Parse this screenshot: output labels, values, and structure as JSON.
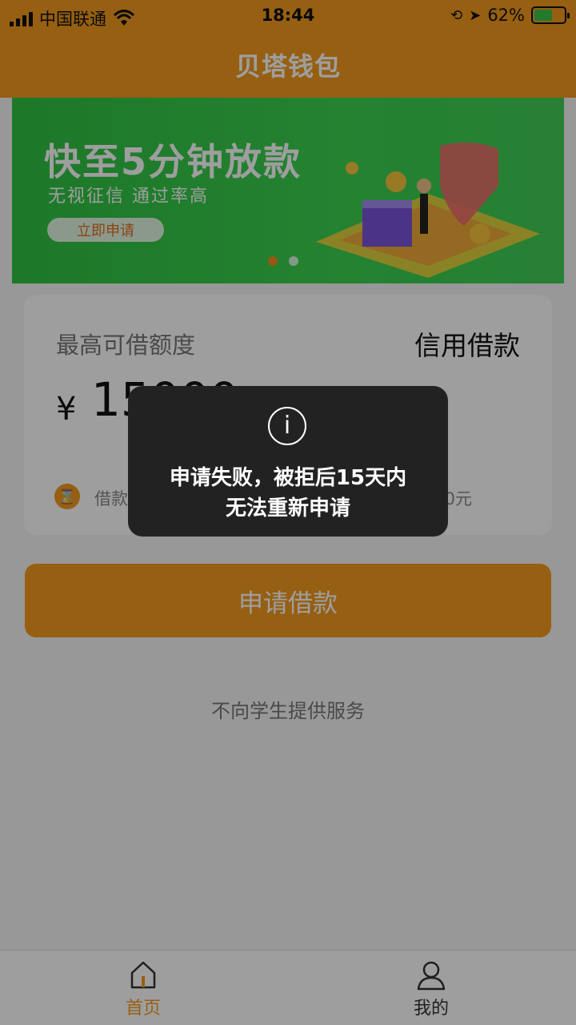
{
  "status_bar": {
    "carrier": "中国联通",
    "time": "18:44",
    "battery": "62%",
    "battery_level": 0.62
  },
  "nav": {
    "title": "贝塔钱包"
  },
  "banner": {
    "title": "快至5分钟放款",
    "subtitle": "无视征信 通过率高",
    "button": "立即申请",
    "active_dot": 0
  },
  "loan_card": {
    "limit_label": "最高可借额度",
    "loan_type": "信用借款",
    "currency": "¥",
    "amount": "15000",
    "period": "借款周期：5-",
    "min_amount": "额：2000元"
  },
  "actions": {
    "apply_button": "申请借款"
  },
  "notice": {
    "disclaimer": "不向学生提供服务"
  },
  "toast": {
    "icon": "info-icon",
    "line1": "申请失败，被拒后15天内",
    "line2": "无法重新申请"
  },
  "tab_bar": {
    "items": [
      {
        "label": "首页",
        "icon": "home-icon",
        "active": true
      },
      {
        "label": "我的",
        "icon": "user-icon",
        "active": false
      }
    ]
  },
  "colors": {
    "brand_orange": "#f29a1e",
    "banner_green": "#37cc4d",
    "toast_bg": "#222222"
  }
}
